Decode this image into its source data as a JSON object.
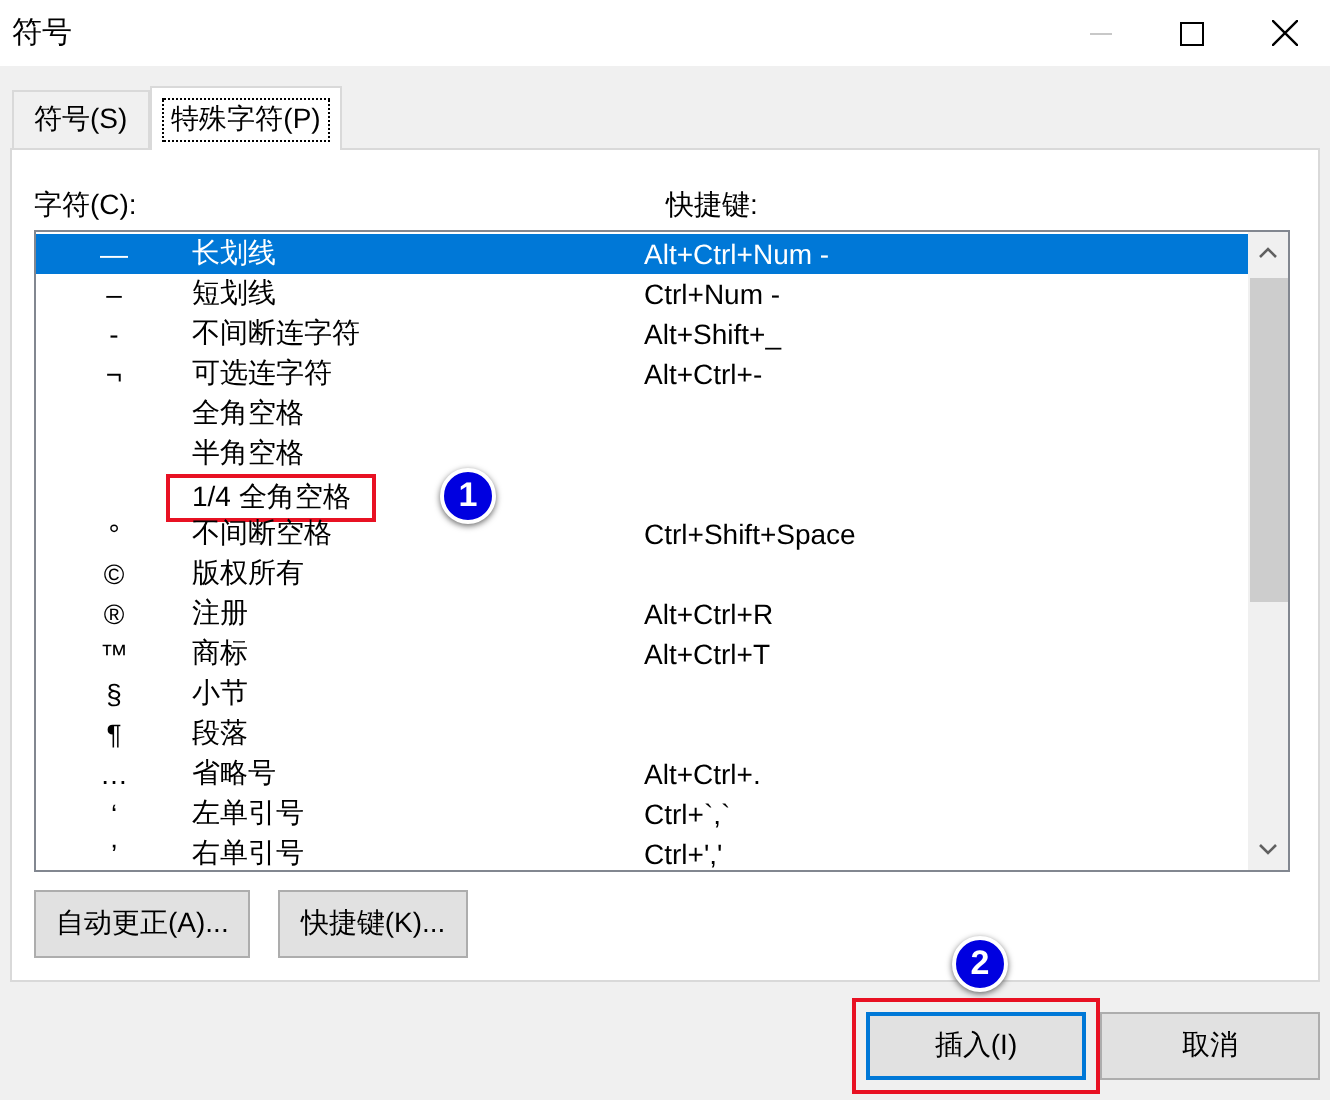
{
  "window": {
    "title": "符号",
    "minimize_disabled": true
  },
  "tabs": [
    {
      "label": "符号(S)",
      "selected": false
    },
    {
      "label": "特殊字符(P)",
      "selected": true
    }
  ],
  "list": {
    "column_1": "字符(C):",
    "column_2": "快捷键:",
    "rows": [
      {
        "symbol": "—",
        "name": "长划线",
        "shortcut": "Alt+Ctrl+Num -",
        "selected": true
      },
      {
        "symbol": "–",
        "name": "短划线",
        "shortcut": "Ctrl+Num -",
        "selected": false
      },
      {
        "symbol": "-",
        "name": "不间断连字符",
        "shortcut": "Alt+Shift+_",
        "selected": false
      },
      {
        "symbol": "¬",
        "name": "可选连字符",
        "shortcut": "Alt+Ctrl+-",
        "selected": false
      },
      {
        "name": "全角空格",
        "selected": false
      },
      {
        "name": "半角空格",
        "selected": false
      },
      {
        "name": "1/4 全角空格",
        "selected": false,
        "marker": "1"
      },
      {
        "symbol": "°",
        "name": "不间断空格",
        "shortcut": "Ctrl+Shift+Space",
        "selected": false
      },
      {
        "symbol": "©",
        "name": "版权所有",
        "selected": false
      },
      {
        "symbol": "®",
        "name": "注册",
        "shortcut": "Alt+Ctrl+R",
        "selected": false
      },
      {
        "symbol": "™",
        "name": "商标",
        "shortcut": "Alt+Ctrl+T",
        "selected": false
      },
      {
        "symbol": "§",
        "name": "小节",
        "selected": false
      },
      {
        "symbol": "¶",
        "name": "段落",
        "selected": false
      },
      {
        "symbol": "…",
        "name": "省略号",
        "shortcut": "Alt+Ctrl+.",
        "selected": false
      },
      {
        "symbol": "‘",
        "name": "左单引号",
        "shortcut": "Ctrl+`,`",
        "selected": false
      },
      {
        "symbol": "’",
        "name": "右单引号",
        "shortcut": "Ctrl+','",
        "selected": false
      }
    ]
  },
  "panel_buttons": [
    {
      "label": "自动更正(A)..."
    },
    {
      "label": "快捷键(K)..."
    }
  ],
  "dialog_buttons": [
    {
      "label": "插入(I)",
      "default": true,
      "marker": "2"
    },
    {
      "label": "取消",
      "default": false
    }
  ]
}
